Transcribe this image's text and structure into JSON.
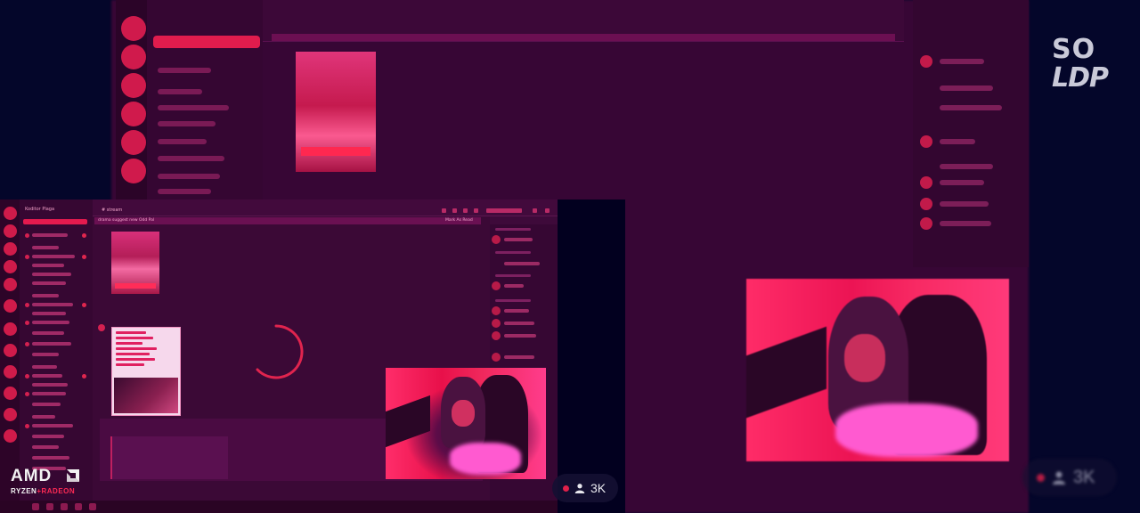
{
  "colors": {
    "background": "#04062a",
    "accent": "#e0204a",
    "overlay_text": "#e8e8ee"
  },
  "screen_share": {
    "server_name": "Koditor Plaga",
    "channel_name": "# stream",
    "banner_text": "drama suggest new Odd Pal",
    "banner_link": "Mark As Read"
  },
  "stream_overlay": {
    "logo_line1": "SO",
    "logo_line2": "LDP",
    "viewer_count": "3K",
    "viewer_count_bg": "3K",
    "viewer_icon": "user-icon",
    "live_dot_icon": "live-dot-icon"
  },
  "sponsor": {
    "brand": "AMD",
    "sub_left": "RYZEN",
    "sub_accent": "+RADEON"
  }
}
